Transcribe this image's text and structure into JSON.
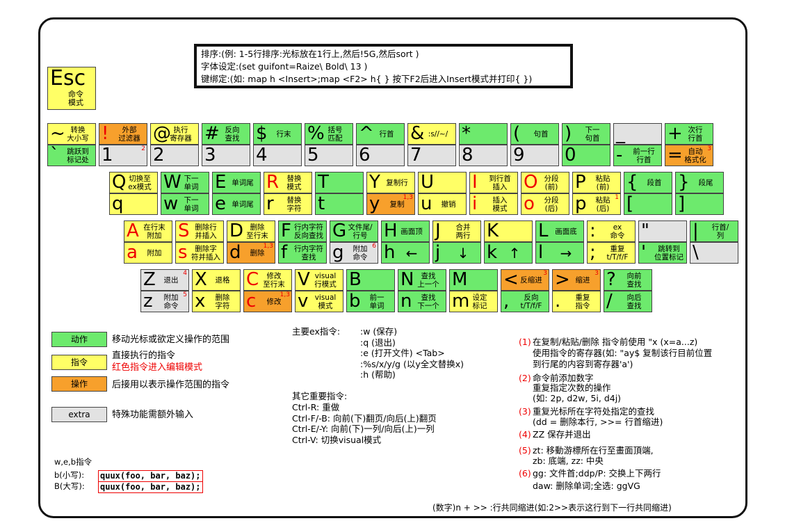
{
  "note": {
    "line1": "排序:(例: 1-5行排序:光标放在1行上,然后!5G,然后sort )",
    "line2": "字体设定:(set guifont=Raize\\ Bold\\ 13 )",
    "line3": "键绑定:(如: map h <Insert>;map <F2> h{ } 按下F2后进入Insert模式并打印{ })"
  },
  "esc": {
    "char": "Esc",
    "desc": "命令\n模式"
  },
  "rows": [
    [
      {
        "u": {
          "c": "~",
          "d": "转换\n大小写",
          "t": "y"
        },
        "l": {
          "c": "`",
          "d": "跳跃到\n标记处",
          "t": "g"
        }
      },
      {
        "u": {
          "c": "!",
          "d": "外部\n过滤器",
          "t": "o",
          "cr": true
        },
        "l": {
          "c": "1",
          "d": "",
          "t": "x",
          "n": "2"
        }
      },
      {
        "u": {
          "c": "@",
          "d": "执行\n寄存器",
          "t": "y"
        },
        "l": {
          "c": "2",
          "d": "",
          "t": "x"
        }
      },
      {
        "u": {
          "c": "#",
          "d": "反向\n查找",
          "t": "g"
        },
        "l": {
          "c": "3",
          "d": "",
          "t": "x"
        }
      },
      {
        "u": {
          "c": "$",
          "d": "行末",
          "t": "g"
        },
        "l": {
          "c": "4",
          "d": "",
          "t": "x"
        }
      },
      {
        "u": {
          "c": "%",
          "d": "括号\n匹配",
          "t": "g"
        },
        "l": {
          "c": "5",
          "d": "",
          "t": "x"
        }
      },
      {
        "u": {
          "c": "^",
          "d": "行首",
          "t": "g"
        },
        "l": {
          "c": "6",
          "d": "",
          "t": "x"
        }
      },
      {
        "u": {
          "c": "&",
          "d": ":s//~/",
          "t": "y"
        },
        "l": {
          "c": "7",
          "d": "",
          "t": "x"
        }
      },
      {
        "u": {
          "c": "*",
          "d": "",
          "t": "g"
        },
        "l": {
          "c": "8",
          "d": "",
          "t": "x"
        }
      },
      {
        "u": {
          "c": "(",
          "d": "句首",
          "t": "g"
        },
        "l": {
          "c": "9",
          "d": "",
          "t": "x"
        }
      },
      {
        "u": {
          "c": ")",
          "d": "下一\n句首",
          "t": "g"
        },
        "l": {
          "c": "0",
          "d": "",
          "t": "g"
        }
      },
      {
        "u": {
          "c": "_",
          "d": "",
          "t": "x"
        },
        "l": {
          "c": "-",
          "d": "前一行\n行首",
          "t": "g"
        }
      },
      {
        "u": {
          "c": "+",
          "d": "次行\n行首",
          "t": "g"
        },
        "l": {
          "c": "=",
          "d": "自动\n格式化",
          "t": "o",
          "n": "3"
        }
      }
    ],
    [
      {
        "u": {
          "c": "Q",
          "d": "切换至\nex模式",
          "t": "y"
        },
        "l": {
          "c": "q",
          "d": "",
          "t": "y"
        }
      },
      {
        "u": {
          "c": "W",
          "d": "下一\n单词",
          "t": "g"
        },
        "l": {
          "c": "w",
          "d": "下一\n单词",
          "t": "g"
        }
      },
      {
        "u": {
          "c": "E",
          "d": "单词尾",
          "t": "g"
        },
        "l": {
          "c": "e",
          "d": "单词尾",
          "t": "g"
        }
      },
      {
        "u": {
          "c": "R",
          "d": "替换\n模式",
          "t": "y",
          "cr": true
        },
        "l": {
          "c": "r",
          "d": "替换\n字符",
          "t": "y"
        }
      },
      {
        "u": {
          "c": "T",
          "d": "",
          "t": "g"
        },
        "l": {
          "c": "t",
          "d": "",
          "t": "g"
        }
      },
      {
        "u": {
          "c": "Y",
          "d": "复制行",
          "t": "y"
        },
        "l": {
          "c": "y",
          "d": "复制",
          "t": "o",
          "n": "1,3"
        }
      },
      {
        "u": {
          "c": "U",
          "d": "",
          "t": "y"
        },
        "l": {
          "c": "u",
          "d": "撤销",
          "t": "y"
        }
      },
      {
        "u": {
          "c": "I",
          "d": "到行首\n插入",
          "t": "y",
          "cr": true
        },
        "l": {
          "c": "i",
          "d": "插入\n模式",
          "t": "y",
          "cr": true
        }
      },
      {
        "u": {
          "c": "O",
          "d": "分段\n(前)",
          "t": "y",
          "cr": true
        },
        "l": {
          "c": "o",
          "d": "分段\n(后)",
          "t": "y",
          "cr": true
        }
      },
      {
        "u": {
          "c": "P",
          "d": "粘贴\n(前)",
          "t": "y"
        },
        "l": {
          "c": "p",
          "d": "粘贴\n(后)",
          "t": "y",
          "n": "1"
        }
      },
      {
        "u": {
          "c": "{",
          "d": "段首",
          "t": "g"
        },
        "l": {
          "c": "[",
          "d": "",
          "t": "g"
        }
      },
      {
        "u": {
          "c": "}",
          "d": "段尾",
          "t": "g"
        },
        "l": {
          "c": "]",
          "d": "",
          "t": "g"
        }
      }
    ],
    [
      {
        "u": {
          "c": "A",
          "d": "在行末\n附加",
          "t": "y",
          "cr": true
        },
        "l": {
          "c": "a",
          "d": "附加",
          "t": "y",
          "cr": true
        }
      },
      {
        "u": {
          "c": "S",
          "d": "删除行\n并插入",
          "t": "y",
          "cr": true
        },
        "l": {
          "c": "s",
          "d": "删除字\n符并插入",
          "t": "y",
          "cr": true
        }
      },
      {
        "u": {
          "c": "D",
          "d": "删除\n至行末",
          "t": "y"
        },
        "l": {
          "c": "d",
          "d": "删除",
          "t": "o",
          "n": "1,3"
        }
      },
      {
        "u": {
          "c": "F",
          "d": "行内字符\n反向查找",
          "t": "g"
        },
        "l": {
          "c": "f",
          "d": "行内字符\n查找",
          "t": "g"
        }
      },
      {
        "u": {
          "c": "G",
          "d": "文件尾/\n行号",
          "t": "g"
        },
        "l": {
          "c": "g",
          "d": "附加\n命令",
          "t": "x",
          "n": "6"
        }
      },
      {
        "u": {
          "c": "H",
          "d": "画面顶",
          "t": "g"
        },
        "l": {
          "c": "h",
          "d": "←",
          "t": "g"
        }
      },
      {
        "u": {
          "c": "J",
          "d": "合并\n两行",
          "t": "y"
        },
        "l": {
          "c": "j",
          "d": "↓",
          "t": "g"
        }
      },
      {
        "u": {
          "c": "K",
          "d": "",
          "t": "y"
        },
        "l": {
          "c": "k",
          "d": "↑",
          "t": "g"
        }
      },
      {
        "u": {
          "c": "L",
          "d": "画面底",
          "t": "g"
        },
        "l": {
          "c": "l",
          "d": "→",
          "t": "g"
        }
      },
      {
        "u": {
          "c": ":",
          "d": "ex\n命令",
          "t": "y"
        },
        "l": {
          "c": ";",
          "d": "重复\nt/T/f/F",
          "t": "y"
        }
      },
      {
        "u": {
          "c": "\"",
          "d": "",
          "t": "x"
        },
        "l": {
          "c": "'",
          "d": "跳转到\n位置标记",
          "t": "g"
        }
      },
      {
        "u": {
          "c": "|",
          "d": "行首/\n列",
          "t": "g"
        },
        "l": {
          "c": "\\",
          "d": "",
          "t": "x"
        }
      }
    ],
    [
      {
        "u": {
          "c": "Z",
          "d": "退出",
          "t": "x",
          "n": "4"
        },
        "l": {
          "c": "z",
          "d": "附加\n命令",
          "t": "x",
          "n": "5"
        }
      },
      {
        "u": {
          "c": "X",
          "d": "退格",
          "t": "y"
        },
        "l": {
          "c": "x",
          "d": "删除\n字符",
          "t": "y"
        }
      },
      {
        "u": {
          "c": "C",
          "d": "修改\n至行末",
          "t": "y",
          "cr": true
        },
        "l": {
          "c": "c",
          "d": "修改",
          "t": "o",
          "cr": true,
          "n": "1,3"
        }
      },
      {
        "u": {
          "c": "V",
          "d": "visual\n行模式",
          "t": "y"
        },
        "l": {
          "c": "v",
          "d": "visual\n模式",
          "t": "y"
        }
      },
      {
        "u": {
          "c": "B",
          "d": "",
          "t": "g"
        },
        "l": {
          "c": "b",
          "d": "前一\n单词",
          "t": "g"
        }
      },
      {
        "u": {
          "c": "N",
          "d": "查找\n上一个",
          "t": "g"
        },
        "l": {
          "c": "n",
          "d": "查找\n下一个",
          "t": "g"
        }
      },
      {
        "u": {
          "c": "M",
          "d": "",
          "t": "g"
        },
        "l": {
          "c": "m",
          "d": "设定\n标记",
          "t": "y"
        }
      },
      {
        "u": {
          "c": "<",
          "d": "反缩进",
          "t": "o",
          "n": "3"
        },
        "l": {
          "c": ",",
          "d": "反向\nt/T/f/F",
          "t": "g"
        }
      },
      {
        "u": {
          "c": ">",
          "d": "缩进",
          "t": "o",
          "n": "3"
        },
        "l": {
          "c": ".",
          "d": "重复\n指令",
          "t": "y"
        }
      },
      {
        "u": {
          "c": "?",
          "d": "向前\n查找",
          "t": "g"
        },
        "l": {
          "c": "/",
          "d": "向后\n查找",
          "t": "g"
        }
      }
    ]
  ],
  "legend": [
    {
      "box": "动作",
      "color": "#6dea6d",
      "text": "移动光标或欲定义操作的范围"
    },
    {
      "box": "指令",
      "color": "#ffff66",
      "text": "直接执行的指令",
      "text2": "红色指令进入编辑模式"
    },
    {
      "box": "操作",
      "color": "#f7a02c",
      "text": "后接用以表示操作范围的指令"
    },
    {
      "box": "extra",
      "color": "#e2e2e2",
      "text": "特殊功能需额外输入"
    }
  ],
  "ex": {
    "title": "主要ex指令:",
    "items": [
      ":w (保存)",
      ":q (退出)",
      ":e (打开文件) <Tab>",
      ":%s/x/y/g (以y全文替换x)",
      ":h (帮助)"
    ]
  },
  "other": {
    "title": "其它重要指令:",
    "items": [
      "Ctrl-R: 重做",
      "Ctrl-F/-B: 向前(下)翻页/向后(上)翻页",
      "Ctrl-E/-Y: 向前(下)一列/向后(上)一列",
      "Ctrl-V: 切换visual模式"
    ]
  },
  "tips": [
    {
      "num": "(1)",
      "lines": [
        "在复制/粘贴/删除 指令前使用 \"x (x=a...z)",
        "使用指令的寄存器(如: \"ay$ 复制该行目前位置",
        "到行尾的内容到寄存器'a')"
      ]
    },
    {
      "num": "(2)",
      "lines": [
        "命令前添加数字",
        "重复指定次数的操作",
        "(如: 2p, d2w, 5i, d4j)"
      ]
    },
    {
      "num": "(3)",
      "lines": [
        "重复光标所在字符处指定的查找",
        "(dd = 删除本行, >>= 行首缩进)"
      ]
    },
    {
      "num": "(4)",
      "lines": [
        "ZZ 保存并退出"
      ]
    },
    {
      "num": "(5)",
      "lines": [
        "zt: 移動游標所在行至畫面頂端,",
        "zb: 底端, zz: 中央"
      ]
    },
    {
      "num": "(6)",
      "lines": [
        "gg: 文件首;ddp/P: 交换上下两行",
        "daw: 删除单词;全选: ggVG"
      ]
    }
  ],
  "wb": {
    "title": "w,e,b指令",
    "small_label": "b(小写):",
    "small_code": "quux(foo, bar, baz);",
    "big_label": "B(大写):",
    "big_code": "quux(foo, bar, baz);"
  },
  "indent": "(数字)n + >> :行共同缩进(如:2>>表示这行到下一行共同缩进)"
}
